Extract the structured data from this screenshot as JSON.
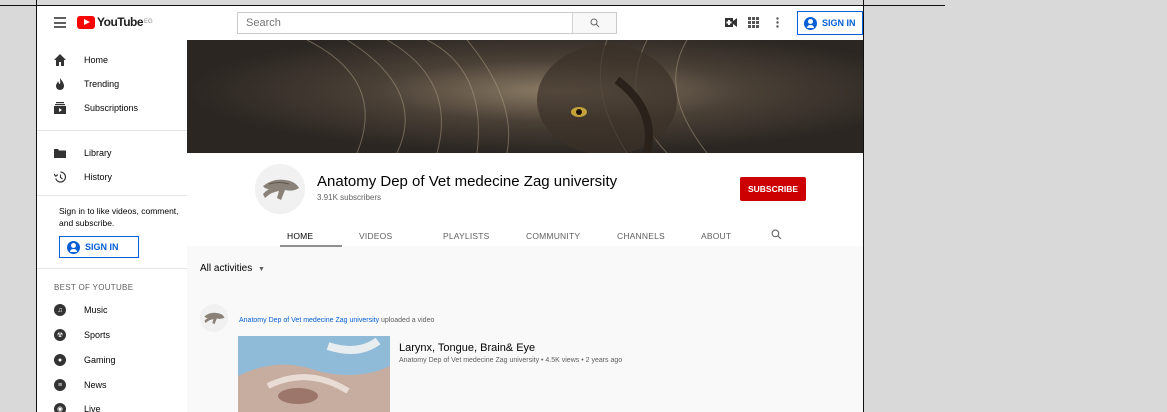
{
  "header": {
    "logo_text": "YouTube",
    "logo_region": "EG",
    "search_placeholder": "Search",
    "sign_in_label": "SIGN IN"
  },
  "sidebar": {
    "primary": [
      {
        "label": "Home",
        "icon": "home-icon"
      },
      {
        "label": "Trending",
        "icon": "flame-icon"
      },
      {
        "label": "Subscriptions",
        "icon": "subscriptions-icon"
      }
    ],
    "secondary": [
      {
        "label": "Library",
        "icon": "folder-icon"
      },
      {
        "label": "History",
        "icon": "history-icon"
      }
    ],
    "signin_note": "Sign in to like videos, comment, and subscribe.",
    "signin_label": "SIGN IN",
    "best_title": "BEST OF YOUTUBE",
    "best": [
      {
        "label": "Music",
        "icon": "music-icon"
      },
      {
        "label": "Sports",
        "icon": "sports-icon"
      },
      {
        "label": "Gaming",
        "icon": "gaming-icon"
      },
      {
        "label": "News",
        "icon": "news-icon"
      },
      {
        "label": "Live",
        "icon": "live-icon"
      }
    ]
  },
  "channel": {
    "title": "Anatomy Dep of Vet medecine Zag university",
    "subscribers": "3.91K subscribers",
    "subscribe_label": "SUBSCRIBE",
    "tabs": [
      "HOME",
      "VIDEOS",
      "PLAYLISTS",
      "COMMUNITY",
      "CHANNELS",
      "ABOUT"
    ],
    "active_tab": "HOME"
  },
  "content": {
    "activities_label": "All activities",
    "feed": {
      "channel_name": "Anatomy Dep of Vet medecine Zag university",
      "action": "uploaded a video",
      "video_title": "Larynx, Tongue, Brain& Eye",
      "video_meta": "Anatomy Dep of Vet medecine Zag university • 4.5K views • 2 years ago"
    }
  },
  "colors": {
    "brand_red": "#ff0000",
    "subscribe_red": "#cc0000",
    "link_blue": "#065fd4"
  }
}
